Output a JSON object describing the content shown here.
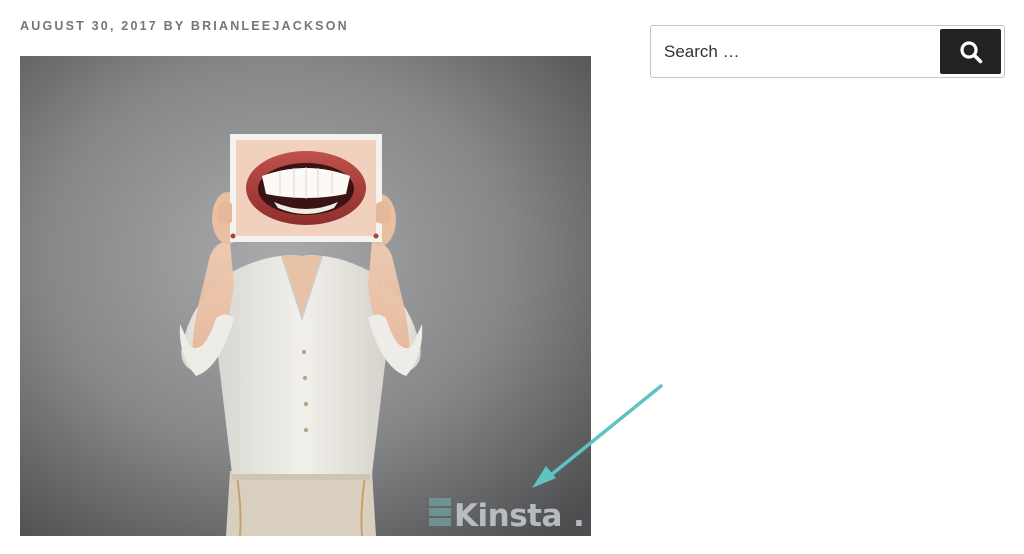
{
  "post": {
    "date": "AUGUST 30, 2017",
    "by": "BY",
    "author": "BRIANLEEJACKSON"
  },
  "image": {
    "watermark_text": "Kinsta",
    "watermark_mark": "."
  },
  "search": {
    "placeholder": "Search …",
    "button_icon": "search-icon"
  },
  "colors": {
    "meta_text": "#767676",
    "search_button": "#222222",
    "arrow": "#5fc4c0"
  }
}
